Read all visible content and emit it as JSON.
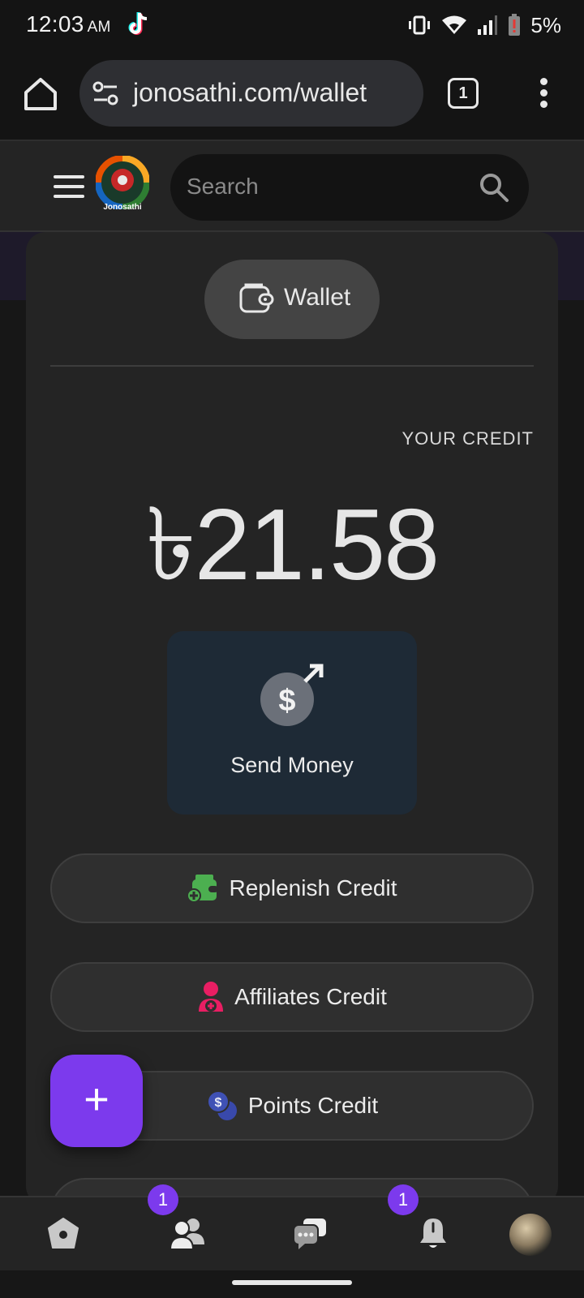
{
  "status_bar": {
    "time": "12:03",
    "ampm": "AM",
    "battery": "5%"
  },
  "browser": {
    "url": "jonosathi.com/wallet",
    "tab_count": "1"
  },
  "site": {
    "logo_text": "Jonosathi",
    "search_placeholder": "Search"
  },
  "wallet": {
    "tab_label": "Wallet",
    "credit_label": "YOUR CREDIT",
    "credit_amount": "৳21.58",
    "send_money_label": "Send Money",
    "buttons": [
      {
        "label": "Replenish Credit",
        "icon": "wallet-add-icon",
        "color": "#4caf50"
      },
      {
        "label": "Affiliates Credit",
        "icon": "user-add-icon",
        "color": "#e91e63"
      },
      {
        "label": "Points Credit",
        "icon": "coins-icon",
        "color": "#3f51b5"
      }
    ]
  },
  "fab": {
    "label": "+"
  },
  "bottom_nav": {
    "items": [
      {
        "name": "home",
        "icon": "home-icon"
      },
      {
        "name": "friends",
        "icon": "people-icon",
        "badge": "1"
      },
      {
        "name": "messages",
        "icon": "chat-icon"
      },
      {
        "name": "notifications",
        "icon": "bell-icon",
        "badge": "1"
      },
      {
        "name": "profile",
        "icon": "avatar"
      }
    ]
  },
  "colors": {
    "accent": "#7c3aed",
    "send_money_bg": "#1e2a36"
  }
}
